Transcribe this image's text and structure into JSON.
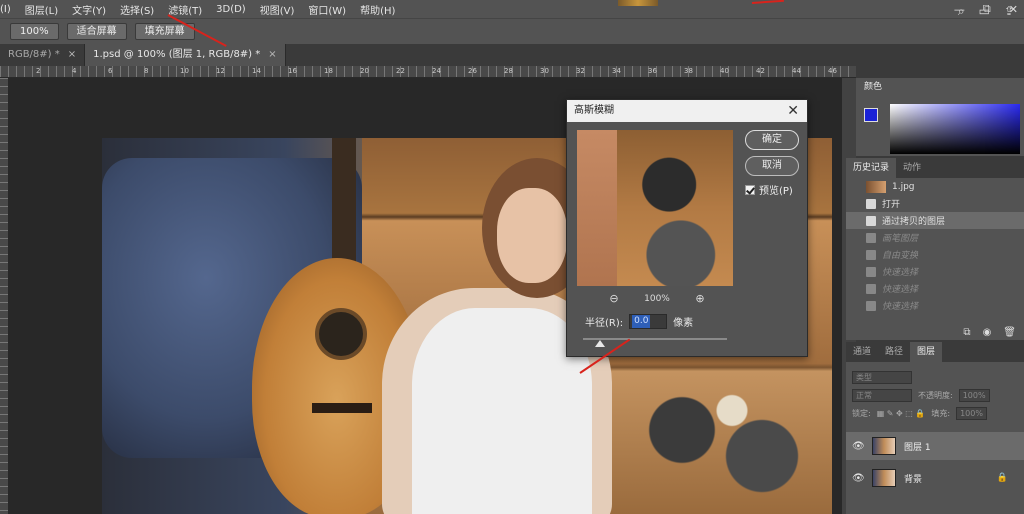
{
  "menu": [
    "(I)",
    "图层(L)",
    "文字(Y)",
    "选择(S)",
    "滤镜(T)",
    "3D(D)",
    "视图(V)",
    "窗口(W)",
    "帮助(H)"
  ],
  "window_controls": [
    "—",
    "⧉",
    "✕"
  ],
  "options_bar": {
    "zoom": "100%",
    "fit_screen": "适合屏幕",
    "fill_screen": "填充屏幕"
  },
  "tabs": [
    {
      "label": "RGB/8#) *",
      "close": "×"
    },
    {
      "label": "1.psd @ 100% (图层 1, RGB/8#) *",
      "close": "×"
    }
  ],
  "ruler_numbers": [
    "2",
    "4",
    "6",
    "8",
    "10",
    "12",
    "14",
    "16",
    "18",
    "20",
    "22",
    "24",
    "26",
    "28",
    "30",
    "32",
    "34",
    "36",
    "38",
    "40",
    "42",
    "44",
    "46"
  ],
  "dialog": {
    "title": "高斯模糊",
    "close": "✕",
    "ok": "确定",
    "cancel": "取消",
    "preview_label": "预览(P)",
    "zoom_out": "⊖",
    "zoom_level": "100%",
    "zoom_in": "⊕",
    "radius_label": "半径(R):",
    "radius_value": "0.0",
    "radius_unit": "像素",
    "radius_slider": 0.12
  },
  "color_panel": {
    "tab": "颜色",
    "foreground": "#1a22d6",
    "background": "#ffffff"
  },
  "history_panel": {
    "tabs": [
      "历史记录",
      "动作"
    ],
    "items": [
      {
        "label": "1.jpg",
        "type": "snapshot"
      },
      {
        "label": "打开",
        "type": "normal"
      },
      {
        "label": "通过拷贝的图层",
        "type": "selected"
      },
      {
        "label": "画笔图层",
        "type": "dim"
      },
      {
        "label": "自由变换",
        "type": "dim"
      },
      {
        "label": "快速选择",
        "type": "dim"
      },
      {
        "label": "快速选择",
        "type": "dim"
      },
      {
        "label": "快速选择",
        "type": "dim"
      }
    ]
  },
  "layers_panel": {
    "tabs": [
      "通道",
      "路径",
      "图层"
    ],
    "kind_filter": "类型",
    "blend_mode": "正常",
    "opacity_label": "不透明度:",
    "opacity_value": "100%",
    "lock_label": "锁定:",
    "fill_label": "填充:",
    "fill_value": "100%",
    "layers": [
      {
        "name": "图层 1",
        "selected": true,
        "locked": false
      },
      {
        "name": "背景",
        "selected": false,
        "locked": true
      }
    ]
  },
  "accent_red": "#d8231c"
}
